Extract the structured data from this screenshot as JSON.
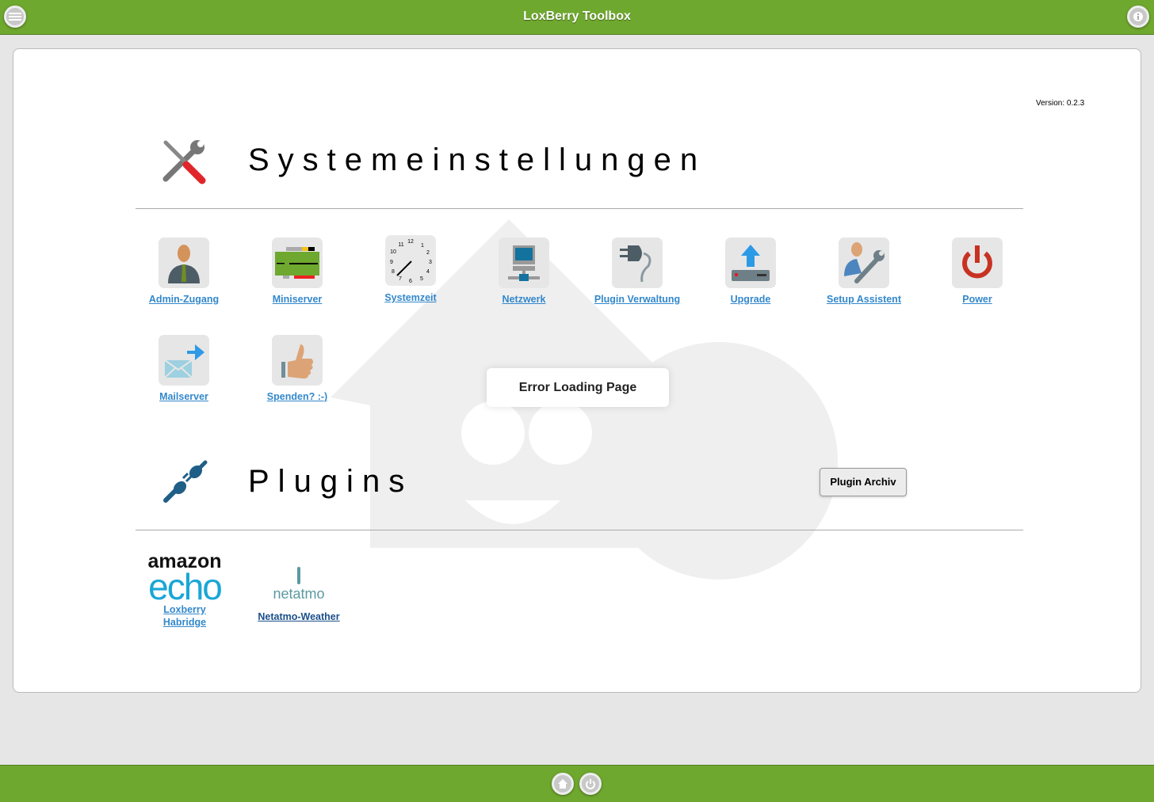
{
  "header": {
    "title": "LoxBerry Toolbox",
    "menu_icon": "menu-icon",
    "info_icon": "info-icon"
  },
  "version": "Version: 0.2.3",
  "system": {
    "title": "Systemeinstellungen",
    "icon": "tools-icon",
    "items": [
      {
        "label": "Admin-Zugang",
        "icon": "admin-user-icon"
      },
      {
        "label": "Miniserver",
        "icon": "miniserver-icon"
      },
      {
        "label": "Systemzeit",
        "icon": "clock-icon"
      },
      {
        "label": "Netzwerk",
        "icon": "network-icon"
      },
      {
        "label": "Plugin Verwaltung",
        "icon": "plug-icon"
      },
      {
        "label": "Upgrade",
        "icon": "upgrade-icon"
      },
      {
        "label": "Setup Assistent",
        "icon": "setup-assistant-icon"
      },
      {
        "label": "Power",
        "icon": "power-icon"
      },
      {
        "label": "Mailserver",
        "icon": "mail-icon"
      },
      {
        "label": "Spenden? :-)",
        "icon": "thumbs-up-icon"
      }
    ]
  },
  "plugins": {
    "title": "Plugins",
    "archive_button": "Plugin Archiv",
    "items": [
      {
        "label_line1": "Loxberry",
        "label_line2": "Habridge",
        "logo_top": "amazon",
        "logo_bottom": "echo"
      },
      {
        "label": "Netatmo-Weather",
        "logo": "netatmo"
      }
    ]
  },
  "error": "Error Loading Page",
  "colors": {
    "accent": "#6fa82f",
    "link": "#3388cc"
  }
}
